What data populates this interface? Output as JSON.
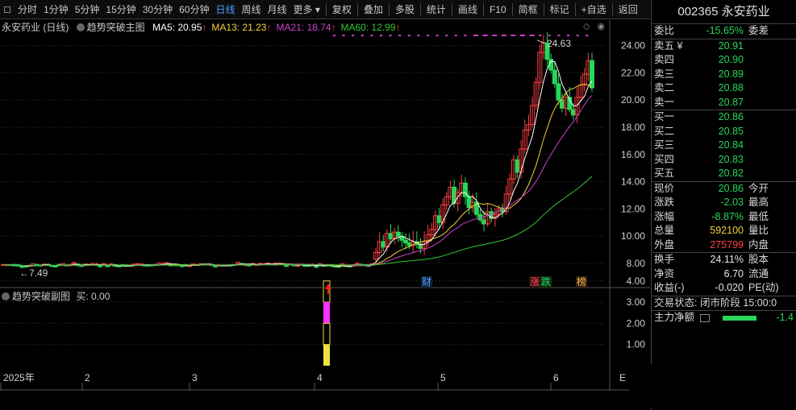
{
  "toolbar": {
    "left_items": [
      {
        "label": "分时",
        "active": false
      },
      {
        "label": "1分钟",
        "active": false
      },
      {
        "label": "5分钟",
        "active": false
      },
      {
        "label": "15分钟",
        "active": false
      },
      {
        "label": "30分钟",
        "active": false
      },
      {
        "label": "60分钟",
        "active": false
      },
      {
        "label": "日线",
        "active": true
      },
      {
        "label": "周线",
        "active": false
      },
      {
        "label": "月线",
        "active": false
      },
      {
        "label": "更多 ▾",
        "active": false
      }
    ],
    "right_items": [
      "复权",
      "叠加",
      "多股",
      "统计",
      "画线",
      "F10",
      "简框",
      "标记",
      "+自选",
      "返回"
    ]
  },
  "main_chart": {
    "stock_label": "永安药业 (日线)",
    "indicator_name": "趋势突破主图",
    "ma": [
      {
        "label": "MA5: 20.95",
        "color": "#ffffff"
      },
      {
        "label": "MA13: 21.23",
        "color": "#f0d23c"
      },
      {
        "label": "MA21: 18.74",
        "color": "#d040d0"
      },
      {
        "label": "MA60: 12.99",
        "color": "#30c830"
      }
    ],
    "ma_arrow": "↑",
    "high_label": "24.63",
    "low_label": "7.49",
    "y_ticks": [
      "24.00",
      "22.00",
      "20.00",
      "18.00",
      "16.00",
      "14.00",
      "12.00",
      "10.00",
      "8.00"
    ],
    "markers": {
      "cai": "财",
      "zhang": "涨",
      "die": "跌",
      "bang": "榜"
    }
  },
  "sub_chart": {
    "title": "趋势突破副图",
    "buy_label": "买: 0.00",
    "y_ticks": [
      "4.00",
      "3.00",
      "2.00",
      "1.00"
    ]
  },
  "x_axis": {
    "labels": [
      "2025年",
      "2",
      "3",
      "4",
      "5",
      "6"
    ],
    "trailing": "E"
  },
  "quote": {
    "title": "002365 永安药业",
    "weibi": {
      "label": "委比",
      "value": "-15.65%",
      "ext": "委差"
    },
    "sell": [
      {
        "label": "卖五 ¥",
        "price": "20.91"
      },
      {
        "label": "卖四",
        "price": "20.90"
      },
      {
        "label": "卖三",
        "price": "20.89"
      },
      {
        "label": "卖二",
        "price": "20.88"
      },
      {
        "label": "卖一",
        "price": "20.87"
      }
    ],
    "buy": [
      {
        "label": "买一",
        "price": "20.86"
      },
      {
        "label": "买二",
        "price": "20.85"
      },
      {
        "label": "买三",
        "price": "20.84"
      },
      {
        "label": "买四",
        "price": "20.83"
      },
      {
        "label": "买五",
        "price": "20.82"
      }
    ],
    "stats": [
      {
        "label": "现价",
        "value": "20.86",
        "color": "grn",
        "ext": "今开"
      },
      {
        "label": "涨跌",
        "value": "-2.03",
        "color": "grn",
        "ext": "最高"
      },
      {
        "label": "涨幅",
        "value": "-8.87%",
        "color": "grn",
        "ext": "最低"
      },
      {
        "label": "总量",
        "value": "592100",
        "color": "yel",
        "ext": "量比"
      },
      {
        "label": "外盘",
        "value": "275799",
        "color": "red",
        "ext": "内盘"
      }
    ],
    "fin": [
      {
        "label": "换手",
        "value": "24.11%",
        "ext": "股本"
      },
      {
        "label": "净资",
        "value": "6.70",
        "ext": "流通"
      },
      {
        "label": "收益(-)",
        "value": "-0.020",
        "ext": "PE(动)"
      }
    ],
    "trade_status": "交易状态: 闭市阶段 15:00:0",
    "main_net": {
      "label": "主力净额",
      "value": "-1.4"
    }
  },
  "colors": {
    "up": "#ff3e3e",
    "down": "#27d75a",
    "grid": "#3a3a3a",
    "axis": "#555555"
  }
}
